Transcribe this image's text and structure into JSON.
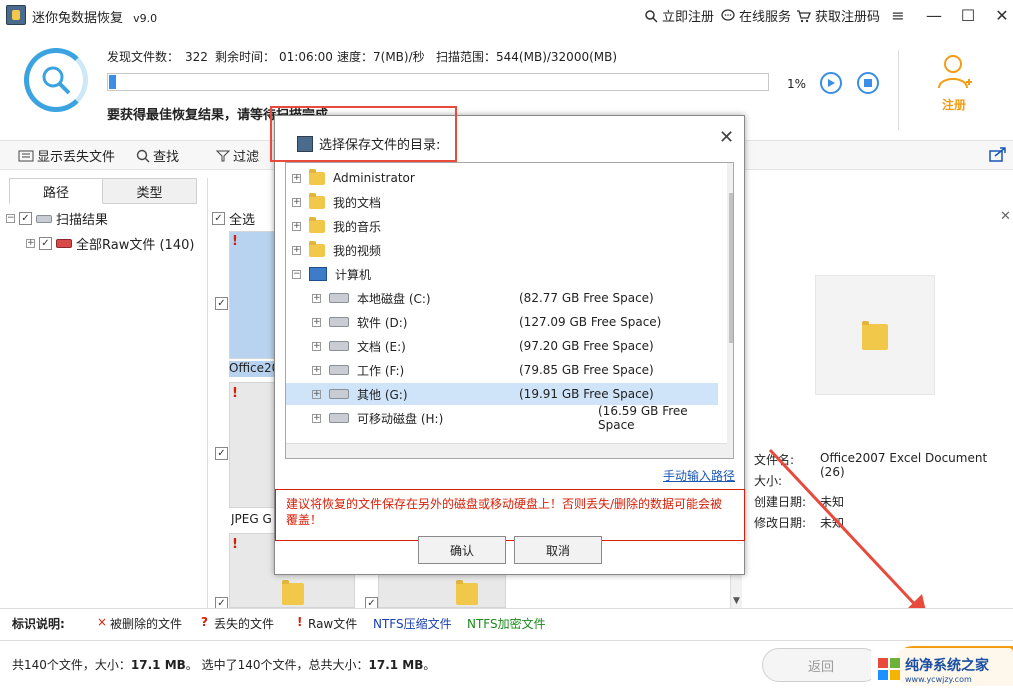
{
  "app": {
    "title": "迷你兔数据恢复",
    "version": "v9.0"
  },
  "titlebar": {
    "register": "立即注册",
    "service": "在线服务",
    "get_code": "获取注册码"
  },
  "scan": {
    "found_label": "发现文件数：",
    "found": "322",
    "remain_label": "剩余时间：",
    "remain": "01:06:00",
    "speed_label": "速度：",
    "speed": "7(MB)/秒",
    "range_label": "扫描范围：",
    "range": "544(MB)/32000(MB)",
    "progress": 0.01,
    "progress_text": "1%",
    "hint": "要获得最佳恢复结果，请等待扫描完成。"
  },
  "register_button": {
    "label": "注册"
  },
  "toolbar": {
    "show_lost": "显示丢失文件",
    "search": "查找",
    "filter": "过滤"
  },
  "tabs": {
    "path": "路径",
    "type": "类型"
  },
  "tree": {
    "root": "扫描结果",
    "child": "全部Raw文件 (140)"
  },
  "grid": {
    "select_all": "全选",
    "item1": "Office20",
    "item2": "JPEG G"
  },
  "info": {
    "name_label": "文件名:",
    "name": "Office2007 Excel Document (26)",
    "size_label": "大小:",
    "created_label": "创建日期:",
    "created": "未知",
    "modified_label": "修改日期:",
    "modified": "未知"
  },
  "dialog": {
    "title": "选择保存文件的目录:",
    "items": [
      {
        "label": "Administrator",
        "free": ""
      },
      {
        "label": "我的文档",
        "free": ""
      },
      {
        "label": "我的音乐",
        "free": ""
      },
      {
        "label": "我的视频",
        "free": ""
      },
      {
        "label": "计算机",
        "free": ""
      },
      {
        "label": "本地磁盘 (C:)",
        "free": "(82.77 GB Free Space)"
      },
      {
        "label": "软件 (D:)",
        "free": "(127.09 GB Free Space)"
      },
      {
        "label": "文档 (E:)",
        "free": "(97.20 GB Free Space)"
      },
      {
        "label": "工作 (F:)",
        "free": "(79.85 GB Free Space)"
      },
      {
        "label": "其他 (G:)",
        "free": "(19.91 GB Free Space)"
      },
      {
        "label": "可移动磁盘 (H:)",
        "free": "(16.59 GB Free Space"
      }
    ],
    "manual_path": "手动输入路径",
    "warning": "建议将恢复的文件保存在另外的磁盘或移动硬盘上！否则丢失/删除的数据可能会被覆盖！",
    "ok": "确认",
    "cancel": "取消"
  },
  "legend": {
    "title": "标识说明:",
    "deleted": "被删除的文件",
    "lost": "丢失的文件",
    "raw": "Raw文件",
    "ntfs_comp": "NTFS压缩文件",
    "ntfs_enc": "NTFS加密文件"
  },
  "status": {
    "total": "共140个文件，大小：",
    "total_size": "17.1 MB",
    "selected": "。 选中了140个文件，总共大小：",
    "selected_size": "17.1 MB",
    "end": "。"
  },
  "back_button": "返回",
  "watermark": {
    "main": "纯净系统之家",
    "sub": "www.ycwjzy.com"
  },
  "colors": {
    "accent": "#3a8ee6",
    "warning": "#d81e06",
    "register": "#f39c12",
    "ntfs_comp": "#1a3fb0",
    "ntfs_enc": "#1b8a1b"
  }
}
